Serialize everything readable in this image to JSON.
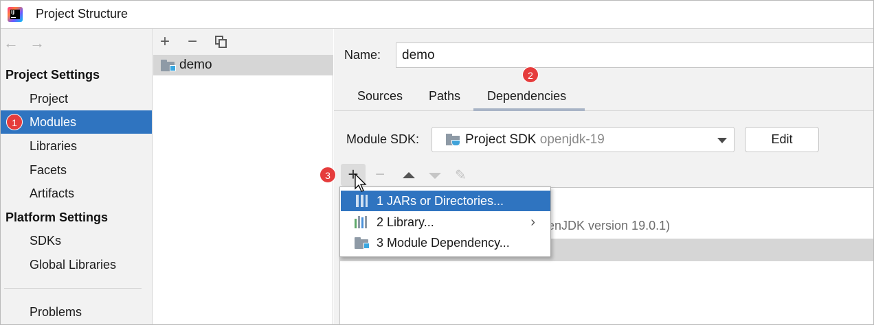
{
  "window": {
    "title": "Project Structure"
  },
  "nav": {
    "back": "←",
    "forward": "→"
  },
  "sidebar": {
    "project_settings_label": "Project Settings",
    "platform_settings_label": "Platform Settings",
    "items": [
      {
        "label": "Project"
      },
      {
        "label": "Modules"
      },
      {
        "label": "Libraries"
      },
      {
        "label": "Facets"
      },
      {
        "label": "Artifacts"
      },
      {
        "label": "SDKs"
      },
      {
        "label": "Global Libraries"
      },
      {
        "label": "Problems"
      }
    ]
  },
  "badges": {
    "one": "1",
    "two": "2",
    "three": "3"
  },
  "modules_toolbar": {
    "add": "+",
    "remove": "−"
  },
  "modules": [
    {
      "label": "demo"
    }
  ],
  "name_field": {
    "label": "Name:",
    "value": "demo"
  },
  "tabs": [
    {
      "label": "Sources"
    },
    {
      "label": "Paths"
    },
    {
      "label": "Dependencies"
    }
  ],
  "sdk": {
    "label": "Module SDK:",
    "value": "Project SDK",
    "version": "openjdk-19",
    "edit_label": "Edit"
  },
  "deps_toolbar": {
    "add": "+",
    "remove": "−"
  },
  "dependencies": {
    "partial_row_text": "enJDK version 19.0.1)"
  },
  "popup_menu": [
    {
      "label": "1  JARs or Directories..."
    },
    {
      "label": "2  Library..."
    },
    {
      "label": "3  Module Dependency..."
    }
  ],
  "colors": {
    "selection": "#2f74c0",
    "badge": "#e53c3c",
    "panel": "#f2f2f2"
  }
}
